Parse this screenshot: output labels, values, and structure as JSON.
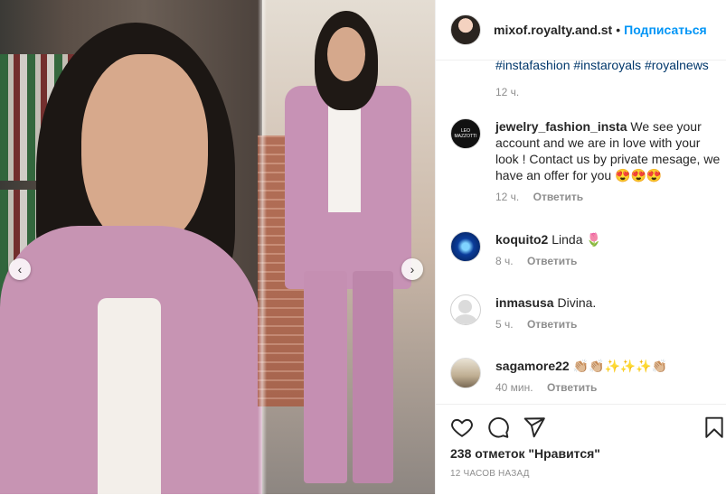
{
  "post": {
    "username": "mixof.royalty.and.st",
    "separator": "•",
    "follow_label": "Подписаться"
  },
  "caption": {
    "hashtags": "#instafashion #instaroyals #royalnews",
    "time": "12 ч."
  },
  "comments": [
    {
      "username": "jewelry_fashion_insta",
      "text": "We see your account and we are in love with your look ! Contact us by private mesage, we have an offer for you 😍😍😍",
      "time": "12 ч.",
      "reply": "Ответить",
      "avatar_text": "LEO MAZZOTTI"
    },
    {
      "username": "koquito2",
      "text": "Linda 🌷",
      "time": "8 ч.",
      "reply": "Ответить"
    },
    {
      "username": "inmasusa",
      "text": "Divina.",
      "time": "5 ч.",
      "reply": "Ответить"
    },
    {
      "username": "sagamore22",
      "text": "👏🏼👏🏼✨✨✨👏🏼",
      "time": "40 мин.",
      "reply": "Ответить"
    }
  ],
  "actions": {
    "icons": [
      "heart-icon",
      "comment-icon",
      "share-icon",
      "bookmark-icon"
    ],
    "likes_text": "238 отметок \"Нравится\"",
    "posted_ago": "12 часов назад"
  },
  "carousel": {
    "prev": "‹",
    "next": "›"
  },
  "colors": {
    "accent": "#0095f6",
    "text": "#262626",
    "muted": "#8e8e8e",
    "hashtag": "#00376b"
  }
}
